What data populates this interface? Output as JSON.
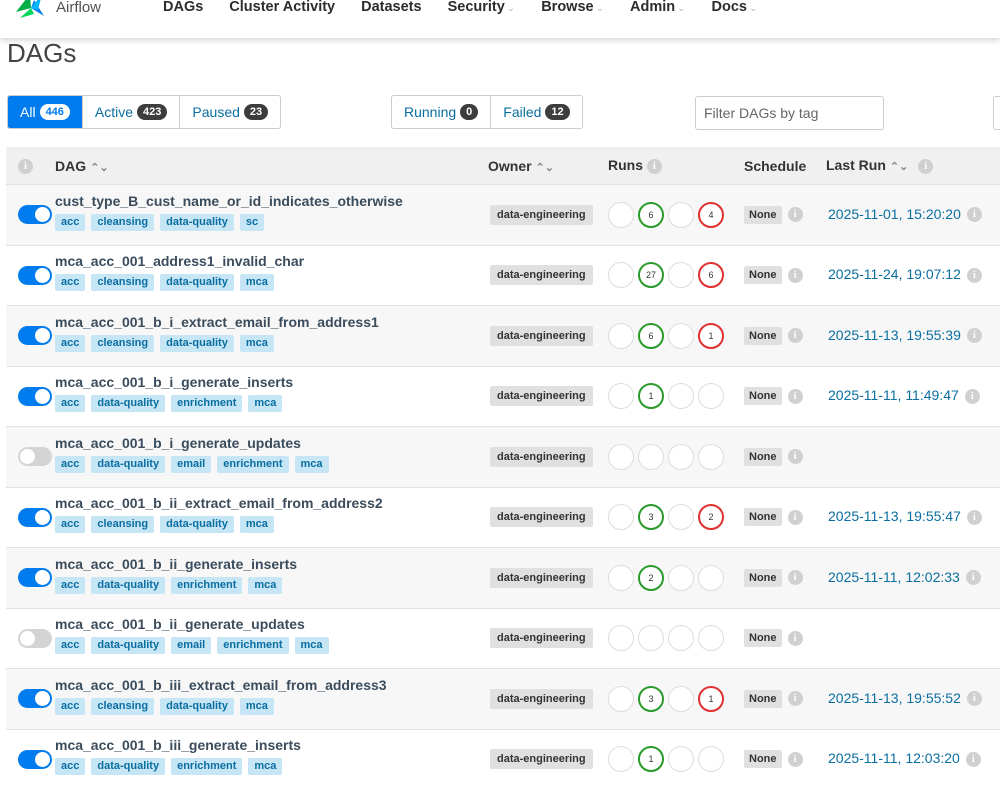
{
  "nav": {
    "brand": "Airflow",
    "links": [
      {
        "label": "DAGs",
        "dropdown": false
      },
      {
        "label": "Cluster Activity",
        "dropdown": false
      },
      {
        "label": "Datasets",
        "dropdown": false
      },
      {
        "label": "Security",
        "dropdown": true
      },
      {
        "label": "Browse",
        "dropdown": true
      },
      {
        "label": "Admin",
        "dropdown": true
      },
      {
        "label": "Docs",
        "dropdown": true
      }
    ]
  },
  "page_title": "DAGs",
  "status_filters": [
    {
      "label": "All",
      "count": "446",
      "active": true
    },
    {
      "label": "Active",
      "count": "423",
      "active": false
    },
    {
      "label": "Paused",
      "count": "23",
      "active": false
    }
  ],
  "state_filters": [
    {
      "label": "Running",
      "count": "0"
    },
    {
      "label": "Failed",
      "count": "12"
    }
  ],
  "tag_filter": {
    "placeholder": "Filter DAGs by tag",
    "value": ""
  },
  "table": {
    "headers": {
      "dag": "DAG",
      "owner": "Owner",
      "runs": "Runs",
      "schedule": "Schedule",
      "last_run": "Last Run"
    },
    "rows": [
      {
        "name": "cust_type_B_cust_name_or_id_indicates_otherwise",
        "active": true,
        "tags": [
          "acc",
          "cleansing",
          "data-quality",
          "sc"
        ],
        "owner": "data-engineering",
        "runs": [
          "",
          "6",
          "",
          "4"
        ],
        "schedule": "None",
        "last_run": "2025-11-01, 15:20:20"
      },
      {
        "name": "mca_acc_001_address1_invalid_char",
        "active": true,
        "tags": [
          "acc",
          "cleansing",
          "data-quality",
          "mca"
        ],
        "owner": "data-engineering",
        "runs": [
          "",
          "27",
          "",
          "6"
        ],
        "schedule": "None",
        "last_run": "2025-11-24, 19:07:12"
      },
      {
        "name": "mca_acc_001_b_i_extract_email_from_address1",
        "active": true,
        "tags": [
          "acc",
          "cleansing",
          "data-quality",
          "mca"
        ],
        "owner": "data-engineering",
        "runs": [
          "",
          "6",
          "",
          "1"
        ],
        "schedule": "None",
        "last_run": "2025-11-13, 19:55:39"
      },
      {
        "name": "mca_acc_001_b_i_generate_inserts",
        "active": true,
        "tags": [
          "acc",
          "data-quality",
          "enrichment",
          "mca"
        ],
        "owner": "data-engineering",
        "runs": [
          "",
          "1",
          "",
          ""
        ],
        "schedule": "None",
        "last_run": "2025-11-11, 11:49:47"
      },
      {
        "name": "mca_acc_001_b_i_generate_updates",
        "active": false,
        "tags": [
          "acc",
          "data-quality",
          "email",
          "enrichment",
          "mca"
        ],
        "owner": "data-engineering",
        "runs": [
          "",
          "",
          "",
          ""
        ],
        "schedule": "None",
        "last_run": ""
      },
      {
        "name": "mca_acc_001_b_ii_extract_email_from_address2",
        "active": true,
        "tags": [
          "acc",
          "cleansing",
          "data-quality",
          "mca"
        ],
        "owner": "data-engineering",
        "runs": [
          "",
          "3",
          "",
          "2"
        ],
        "schedule": "None",
        "last_run": "2025-11-13, 19:55:47"
      },
      {
        "name": "mca_acc_001_b_ii_generate_inserts",
        "active": true,
        "tags": [
          "acc",
          "data-quality",
          "enrichment",
          "mca"
        ],
        "owner": "data-engineering",
        "runs": [
          "",
          "2",
          "",
          ""
        ],
        "schedule": "None",
        "last_run": "2025-11-11, 12:02:33"
      },
      {
        "name": "mca_acc_001_b_ii_generate_updates",
        "active": false,
        "tags": [
          "acc",
          "data-quality",
          "email",
          "enrichment",
          "mca"
        ],
        "owner": "data-engineering",
        "runs": [
          "",
          "",
          "",
          ""
        ],
        "schedule": "None",
        "last_run": ""
      },
      {
        "name": "mca_acc_001_b_iii_extract_email_from_address3",
        "active": true,
        "tags": [
          "acc",
          "cleansing",
          "data-quality",
          "mca"
        ],
        "owner": "data-engineering",
        "runs": [
          "",
          "3",
          "",
          "1"
        ],
        "schedule": "None",
        "last_run": "2025-11-13, 19:55:52"
      },
      {
        "name": "mca_acc_001_b_iii_generate_inserts",
        "active": true,
        "tags": [
          "acc",
          "data-quality",
          "enrichment",
          "mca"
        ],
        "owner": "data-engineering",
        "runs": [
          "",
          "1",
          "",
          ""
        ],
        "schedule": "None",
        "last_run": "2025-11-11, 12:03:20"
      }
    ]
  },
  "colors": {
    "accent": "#017cee",
    "success": "#2a9b2a",
    "failed": "#e03030",
    "tag_bg": "#c6e5f5",
    "link": "#0a6ea1"
  }
}
